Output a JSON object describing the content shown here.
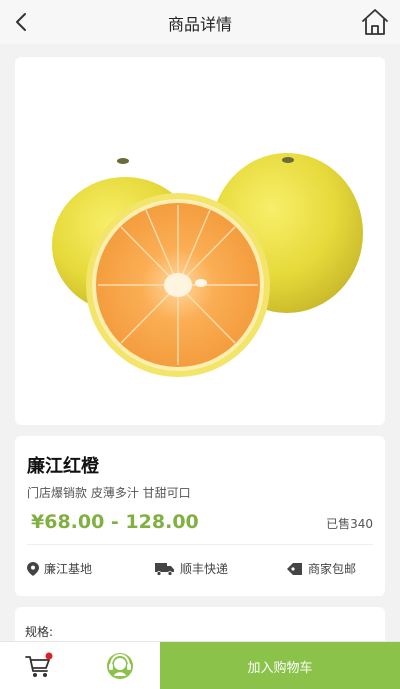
{
  "header": {
    "title": "商品详情"
  },
  "product": {
    "name": "廉江红橙",
    "description": "门店爆销款 皮薄多汁 甘甜可口",
    "price_range": "¥68.00 - 128.00",
    "sold_text": "已售340",
    "features": [
      {
        "icon": "location-pin-icon",
        "label": "廉江基地"
      },
      {
        "icon": "delivery-truck-icon",
        "label": "顺丰快递"
      },
      {
        "icon": "price-tag-icon",
        "label": "商家包邮"
      }
    ]
  },
  "spec": {
    "label": "规格:"
  },
  "bottom_bar": {
    "add_to_cart_label": "加入购物车",
    "cart_badge_color": "#e02020"
  },
  "colors": {
    "accent": "#8bc34a",
    "price": "#7fb040"
  }
}
